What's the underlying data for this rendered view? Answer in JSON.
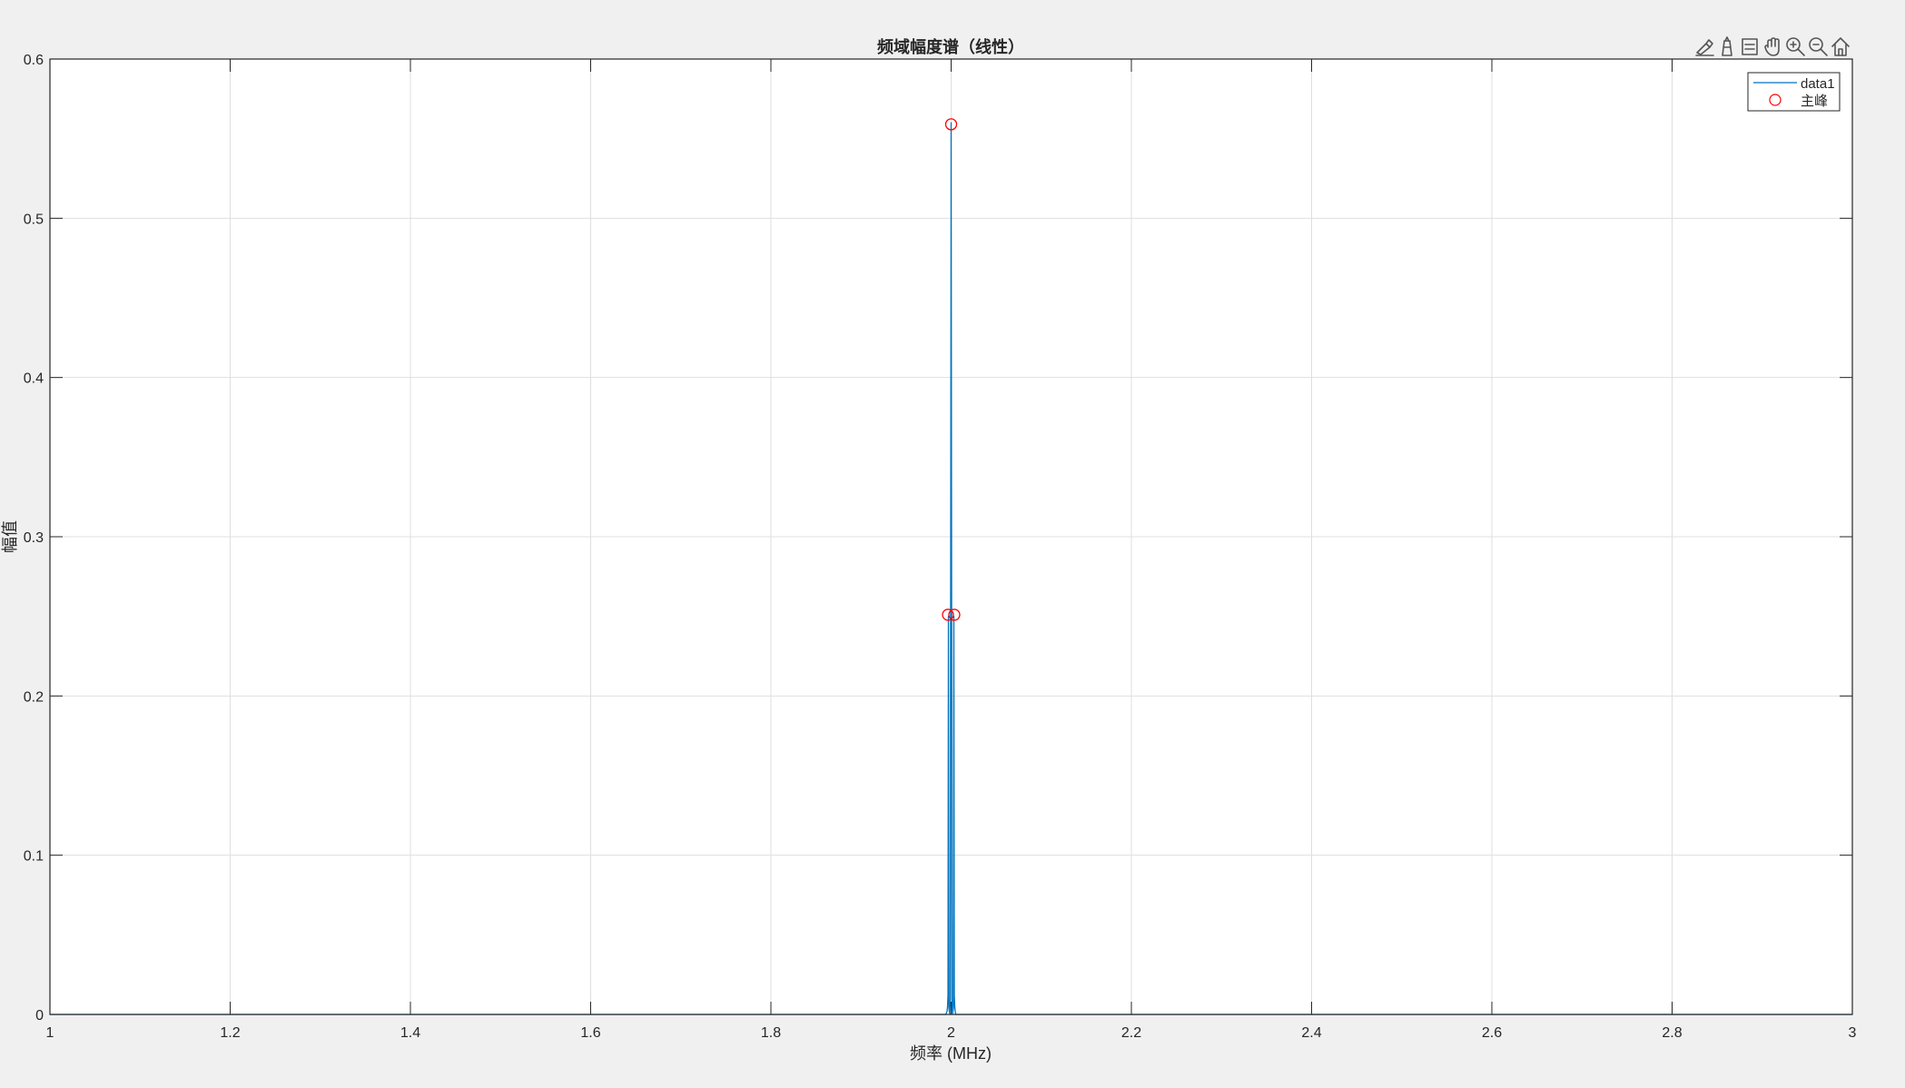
{
  "colors": {
    "figure_background": "#f0f0f0",
    "axes_background": "#ffffff",
    "grid": "#dfdfdf",
    "axis": "#262626",
    "series_line": "#0072bd",
    "peak_marker": "#ff0000"
  },
  "toolbar": {
    "icons": [
      "brush-icon",
      "datatip-icon",
      "legend-toggle-icon",
      "pan-hand-icon",
      "zoom-in-icon",
      "zoom-out-icon",
      "home-icon"
    ]
  },
  "chart_data": {
    "type": "line",
    "title": "频域幅度谱（线性）",
    "xlabel": "频率 (MHz)",
    "ylabel": "幅值",
    "xlim": [
      1,
      3
    ],
    "ylim": [
      0,
      0.6
    ],
    "xticks": [
      1,
      1.2,
      1.4,
      1.6,
      1.8,
      2,
      2.2,
      2.4,
      2.6,
      2.8,
      3
    ],
    "xtick_labels": [
      "1",
      "1.2",
      "1.4",
      "1.6",
      "1.8",
      "2",
      "2.2",
      "2.4",
      "2.6",
      "2.8",
      "3"
    ],
    "yticks": [
      0,
      0.1,
      0.2,
      0.3,
      0.4,
      0.5,
      0.6
    ],
    "ytick_labels": [
      "0",
      "0.1",
      "0.2",
      "0.3",
      "0.4",
      "0.5",
      "0.6"
    ],
    "grid": true,
    "legend": {
      "placement": "top-right",
      "entries": [
        {
          "label": "data1",
          "kind": "line"
        },
        {
          "label": "主峰",
          "kind": "marker"
        }
      ]
    },
    "series": [
      {
        "name": "data1",
        "kind": "line",
        "x": [
          1.0,
          1.98,
          1.994,
          1.9955,
          1.996,
          1.9965,
          1.997,
          1.9975,
          1.998,
          1.9985,
          1.999,
          1.9995,
          2.0,
          2.0005,
          2.001,
          2.0015,
          2.002,
          2.0025,
          2.003,
          2.0035,
          2.004,
          2.0045,
          2.005,
          2.0065,
          2.02,
          3.0
        ],
        "y": [
          0.0,
          0.0,
          0.0,
          0.002,
          0.005,
          0.012,
          0.25,
          0.004,
          0.002,
          0.0,
          0.01,
          0.28,
          0.56,
          0.28,
          0.01,
          0.0,
          0.002,
          0.004,
          0.25,
          0.012,
          0.005,
          0.002,
          0.0,
          0.0,
          0.0,
          0.0
        ]
      },
      {
        "name": "主峰",
        "kind": "marker",
        "x": [
          1.9965,
          2.0,
          2.0035
        ],
        "y": [
          0.251,
          0.559,
          0.251
        ]
      }
    ]
  }
}
